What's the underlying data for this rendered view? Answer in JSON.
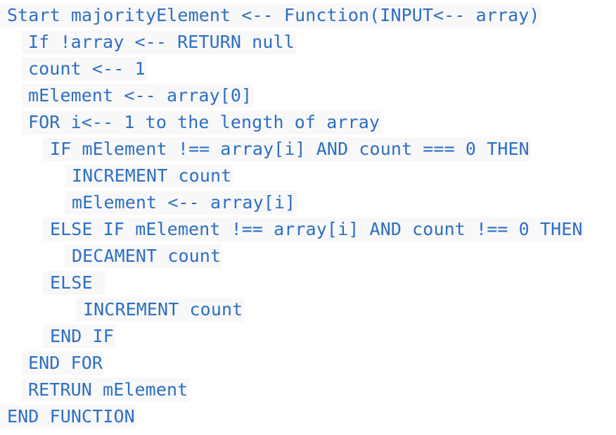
{
  "code": {
    "lines": [
      "Start majorityElement <-- Function(INPUT<-- array)",
      "If !array <-- RETURN null",
      "count <-- 1",
      "mElement <-- array[0]",
      "FOR i<-- 1 to the length of array",
      "IF mElement !== array[i] AND count === 0 THEN",
      "INCREMENT count",
      "mElement <-- array[i]",
      "ELSE IF mElement !== array[i] AND count !== 0 THEN",
      "DECAMENT count",
      "ELSE ",
      "INCREMENT count",
      "END IF",
      "END FOR",
      "RETRUN mElement",
      "END FUNCTION"
    ]
  },
  "colors": {
    "text": "#2d6fc4",
    "line_background": "#f8f8f8",
    "page_background": "#ffffff"
  }
}
